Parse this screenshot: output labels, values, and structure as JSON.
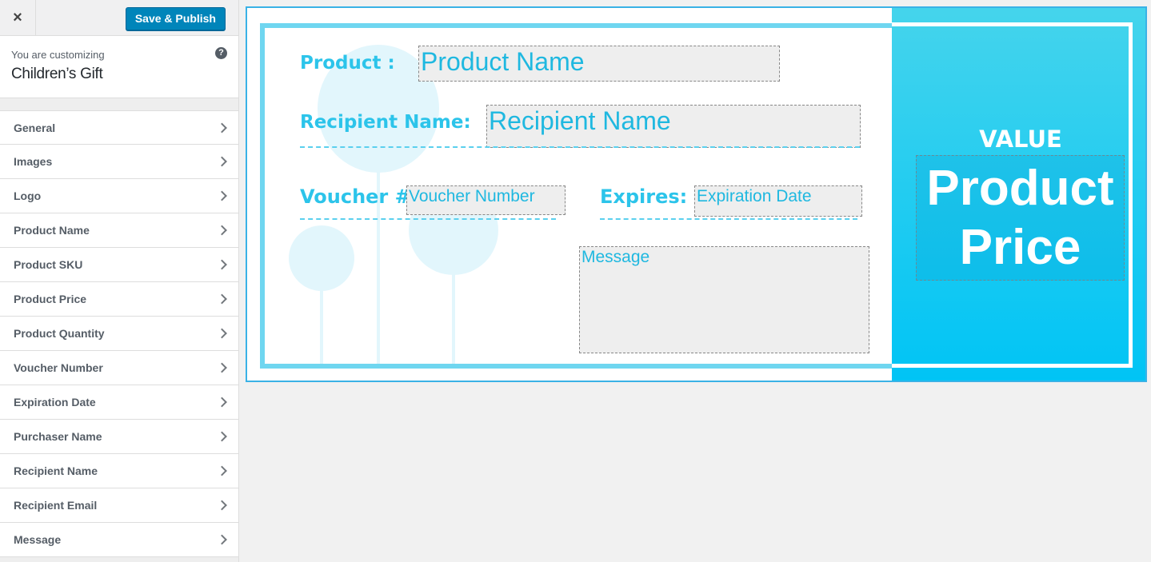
{
  "topbar": {
    "close_icon": "×",
    "publish_label": "Save & Publish"
  },
  "info": {
    "customizing_label": "You are customizing",
    "title": "Children’s Gift",
    "help_icon": "?"
  },
  "menu": [
    {
      "label": "General"
    },
    {
      "label": "Images"
    },
    {
      "label": "Logo"
    },
    {
      "label": "Product Name"
    },
    {
      "label": "Product SKU"
    },
    {
      "label": "Product Price"
    },
    {
      "label": "Product Quantity"
    },
    {
      "label": "Voucher Number"
    },
    {
      "label": "Expiration Date"
    },
    {
      "label": "Purchaser Name"
    },
    {
      "label": "Recipient Name"
    },
    {
      "label": "Recipient Email"
    },
    {
      "label": "Message"
    }
  ],
  "voucher": {
    "product_label": "Product :",
    "product_value": "Product Name",
    "recipient_label": "Recipient Name:",
    "recipient_value": "Recipient Name",
    "voucher_label": "Voucher #",
    "voucher_value": "Voucher Number",
    "expires_label": "Expires:",
    "expires_value": "Expiration Date",
    "message_value": "Message",
    "value_label": "VALUE",
    "price_line1": "Product",
    "price_line2": "Price",
    "accent_color": "#2cc4ea"
  }
}
